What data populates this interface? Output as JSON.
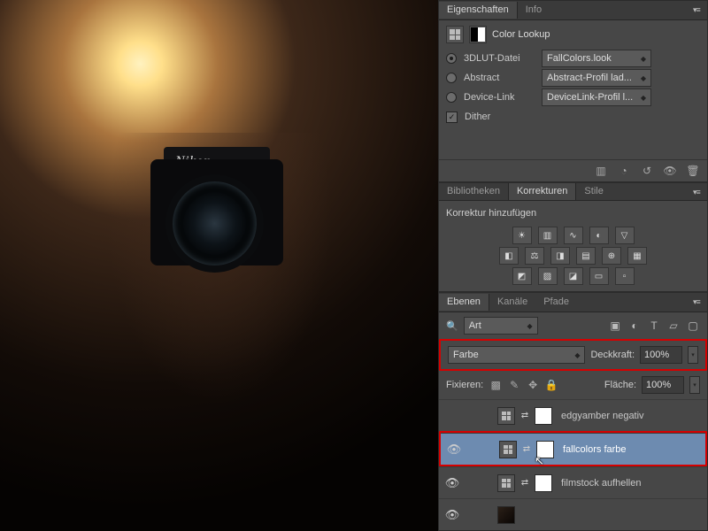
{
  "canvas": {
    "camera_brand": "Nikon"
  },
  "properties": {
    "tabs": [
      "Eigenschaften",
      "Info"
    ],
    "title": "Color Lookup",
    "rows": {
      "r1": {
        "label": "3DLUT-Datei",
        "value": "FallColors.look"
      },
      "r2": {
        "label": "Abstract",
        "value": "Abstract-Profil lad..."
      },
      "r3": {
        "label": "Device-Link",
        "value": "DeviceLink-Profil l..."
      },
      "dither": "Dither"
    }
  },
  "adjustments": {
    "tabs": [
      "Bibliotheken",
      "Korrekturen",
      "Stile"
    ],
    "subtitle": "Korrektur hinzufügen"
  },
  "layers": {
    "tabs": [
      "Ebenen",
      "Kanäle",
      "Pfade"
    ],
    "filter_label": "Art",
    "blend_mode": "Farbe",
    "opacity_label": "Deckkraft:",
    "opacity_value": "100%",
    "lock_label": "Fixieren:",
    "fill_label": "Fläche:",
    "fill_value": "100%",
    "items": [
      {
        "name": "edgyamber negativ",
        "visible": false,
        "selected": false
      },
      {
        "name": "fallcolors farbe",
        "visible": true,
        "selected": true
      },
      {
        "name": "filmstock aufhellen",
        "visible": true,
        "selected": false
      }
    ]
  }
}
